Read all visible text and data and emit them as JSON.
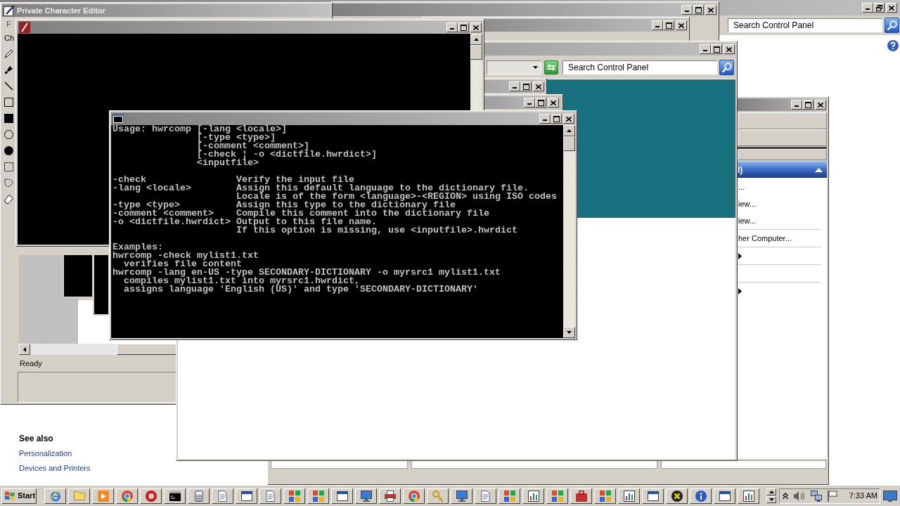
{
  "control_panel": {
    "search": {
      "placeholder": "Search Control Panel"
    },
    "see_also": {
      "heading": "See also",
      "links": [
        "Personalization",
        "Devices and Printers"
      ]
    }
  },
  "private_character_editor": {
    "title": "Private Character Editor",
    "menu": [
      "F"
    ],
    "toolbar_label": "Ch",
    "status": "Ready"
  },
  "tasks_window": {
    "header": "l)",
    "expanded": true,
    "groups": [
      [
        {
          "label": "...",
          "submenu": false
        },
        {
          "label": "iew...",
          "submenu": false
        },
        {
          "label": "iew...",
          "submenu": false
        }
      ],
      [
        {
          "label": "her Computer...",
          "submenu": false
        }
      ],
      [
        {
          "submenu": true
        }
      ],
      [
        {
          "submenu": false
        }
      ],
      [
        {
          "submenu": true
        }
      ]
    ]
  },
  "control_panel_window": {
    "search": {
      "placeholder": "Search Control Panel"
    }
  },
  "console_window": {
    "usage": {
      "command": "Usage: hwrcomp",
      "arguments": [
        "[-lang <locale>]",
        "[-type <type>]",
        "[-comment <comment>]",
        "[-check ¦ -o <dictfile.hwrdict>]",
        "<inputfile>"
      ]
    },
    "options": [
      {
        "flag": "-check",
        "description": [
          "Verify the input file"
        ]
      },
      {
        "flag": "-lang <locale>",
        "description": [
          "Assign this default language to the dictionary file.",
          "Locale is of the form <language>-<REGION> using ISO codes"
        ]
      },
      {
        "flag": "-type <type>",
        "description": [
          "Assign this type to the dictionary file"
        ]
      },
      {
        "flag": "-comment <comment>",
        "description": [
          "Compile this comment into the dictionary file"
        ]
      },
      {
        "flag": "-o <dictfile.hwrdict>",
        "description": [
          "Output to this file name.",
          "If this option is missing, use <inputfile>.hwrdict"
        ]
      }
    ],
    "examples_heading": "Examples:",
    "examples": [
      {
        "command": "hwrcomp -check mylist1.txt",
        "notes": [
          "verifies file content"
        ]
      },
      {
        "command": "hwrcomp -lang en-US -type SECONDARY-DICTIONARY -o myrsrc1 mylist1.txt",
        "notes": [
          "compiles mylist1.txt into myrsrc1.hwrdict,",
          "assigns language 'English (US)' and type 'SECONDARY-DICTIONARY'"
        ]
      }
    ]
  },
  "taskbar": {
    "start": "Start",
    "clock": "7:33 AM"
  }
}
